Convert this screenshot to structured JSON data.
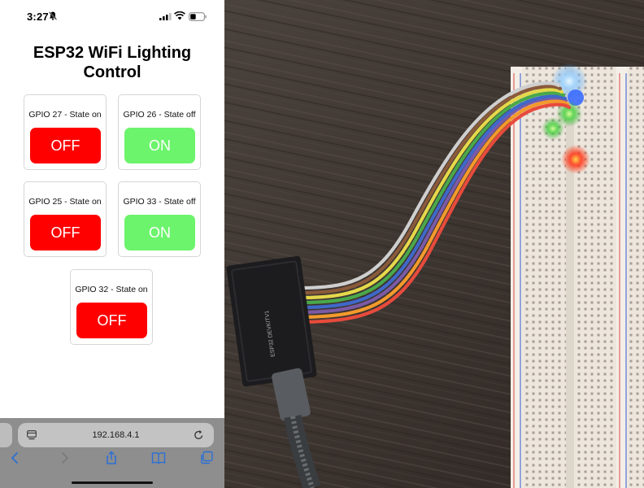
{
  "status_bar": {
    "time": "3:27"
  },
  "page": {
    "title_line1": "ESP32 WiFi Lighting",
    "title_line2": "Control"
  },
  "gpio_cards": [
    {
      "label": "GPIO 27 - State on",
      "button": "OFF",
      "button_color": "#fe0000"
    },
    {
      "label": "GPIO 26 - State off",
      "button": "ON",
      "button_color": "#6cf46c"
    },
    {
      "label": "GPIO 25 - State on",
      "button": "OFF",
      "button_color": "#fe0000"
    },
    {
      "label": "GPIO 33 - State off",
      "button": "ON",
      "button_color": "#6cf46c"
    },
    {
      "label": "GPIO 32 - State on",
      "button": "OFF",
      "button_color": "#fe0000"
    }
  ],
  "browser": {
    "url": "192.168.4.1",
    "icons": [
      "site-settings-icon",
      "reload-icon",
      "back-icon",
      "forward-icon",
      "share-icon",
      "bookmarks-icon",
      "tabs-icon"
    ]
  },
  "photo": {
    "description_icons": [
      "esp32-board",
      "breadboard",
      "rainbow-ribbon-cable",
      "usb-cable",
      "leds"
    ],
    "board_text": "ESP32 DEVKITV1",
    "wire_colors": [
      "#7b5aa6",
      "#3f68c9",
      "#4aa84a",
      "#e5d84a",
      "#f39a2c",
      "#e74b3c",
      "#8a5a3a"
    ]
  },
  "colors": {
    "off_button": "#fe0000",
    "on_button": "#6cf46c",
    "safari_toolbar": "#8e8e8e",
    "safari_link_blue": "#2a6fd6"
  }
}
